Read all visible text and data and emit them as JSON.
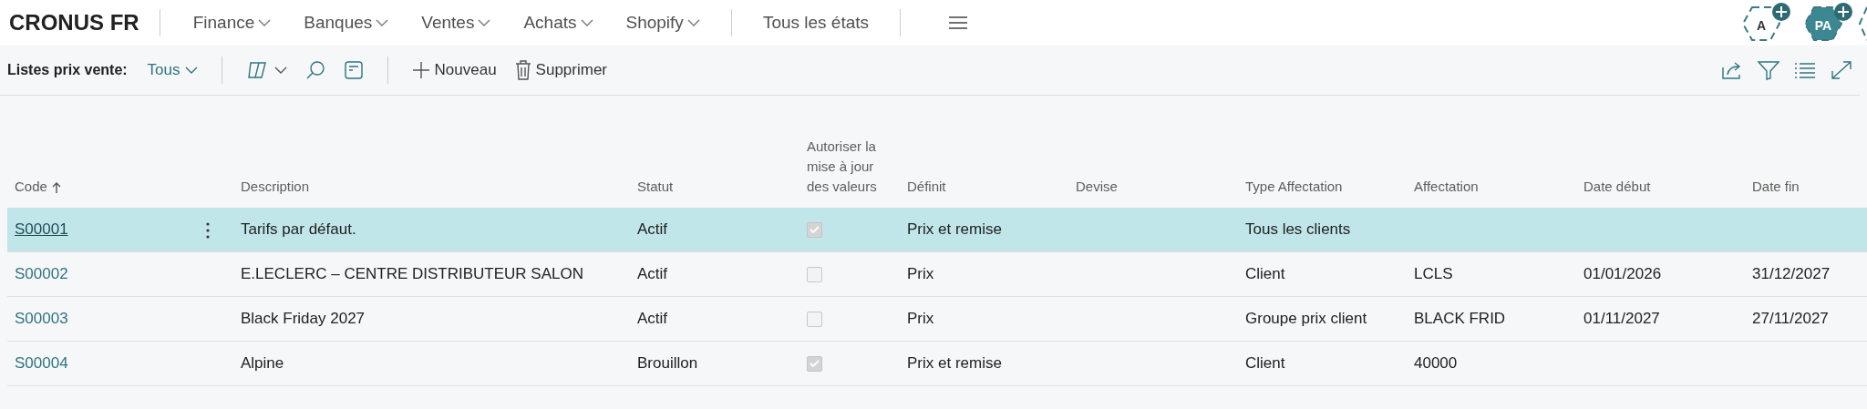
{
  "app": {
    "company": "CRONUS FR",
    "menus": [
      {
        "label": "Finance",
        "dropdown": true
      },
      {
        "label": "Banques",
        "dropdown": true
      },
      {
        "label": "Ventes",
        "dropdown": true
      },
      {
        "label": "Achats",
        "dropdown": true
      },
      {
        "label": "Shopify",
        "dropdown": true
      },
      {
        "label": "Tous les états",
        "dropdown": false
      }
    ],
    "avatars": [
      {
        "initials": "A",
        "kind": "outline"
      },
      {
        "initials": "PA",
        "kind": "filled"
      },
      {
        "kind": "partial"
      }
    ]
  },
  "action_bar": {
    "title": "Listes prix vente:",
    "view": "Tous",
    "actions": [
      {
        "label": "Nouveau",
        "kind": "new"
      },
      {
        "label": "Supprimer",
        "kind": "delete"
      }
    ]
  },
  "table": {
    "columns": [
      {
        "label": "Code",
        "sorted": true
      },
      {
        "label": "Description",
        "sorted": false
      },
      {
        "label": "Statut",
        "sorted": false
      },
      {
        "label": "Autoriser la mise à jour des valeurs",
        "sorted": false
      },
      {
        "label": "Définit",
        "sorted": false
      },
      {
        "label": "Devise",
        "sorted": false
      },
      {
        "label": "Type Affectation",
        "sorted": false
      },
      {
        "label": "Affectation",
        "sorted": false
      },
      {
        "label": "Date début",
        "sorted": false
      },
      {
        "label": "Date fin",
        "sorted": false
      }
    ],
    "rows": [
      {
        "selected": true,
        "code": "S00001",
        "description": "Tarifs par défaut.",
        "statut": "Actif",
        "allow_update": true,
        "definit": "Prix et remise",
        "type_affectation": "Tous les clients"
      },
      {
        "selected": false,
        "code": "S00002",
        "description": "E.LECLERC – CENTRE DISTRIBUTEUR SALON",
        "statut": "Actif",
        "allow_update": false,
        "definit": "Prix",
        "type_affectation": "Client",
        "affectation": "LCLS",
        "date_debut": "01/01/2026",
        "date_fin": "31/12/2027"
      },
      {
        "selected": false,
        "code": "S00003",
        "description": "Black Friday 2027",
        "statut": "Actif",
        "allow_update": false,
        "definit": "Prix",
        "type_affectation": "Groupe prix client",
        "affectation": "BLACK FRID",
        "date_debut": "01/11/2027",
        "date_fin": "27/11/2027"
      },
      {
        "selected": false,
        "code": "S00004",
        "description": "Alpine",
        "statut": "Brouillon",
        "allow_update": true,
        "definit": "Prix et remise",
        "type_affectation": "Client",
        "affectation": "40000"
      }
    ]
  }
}
